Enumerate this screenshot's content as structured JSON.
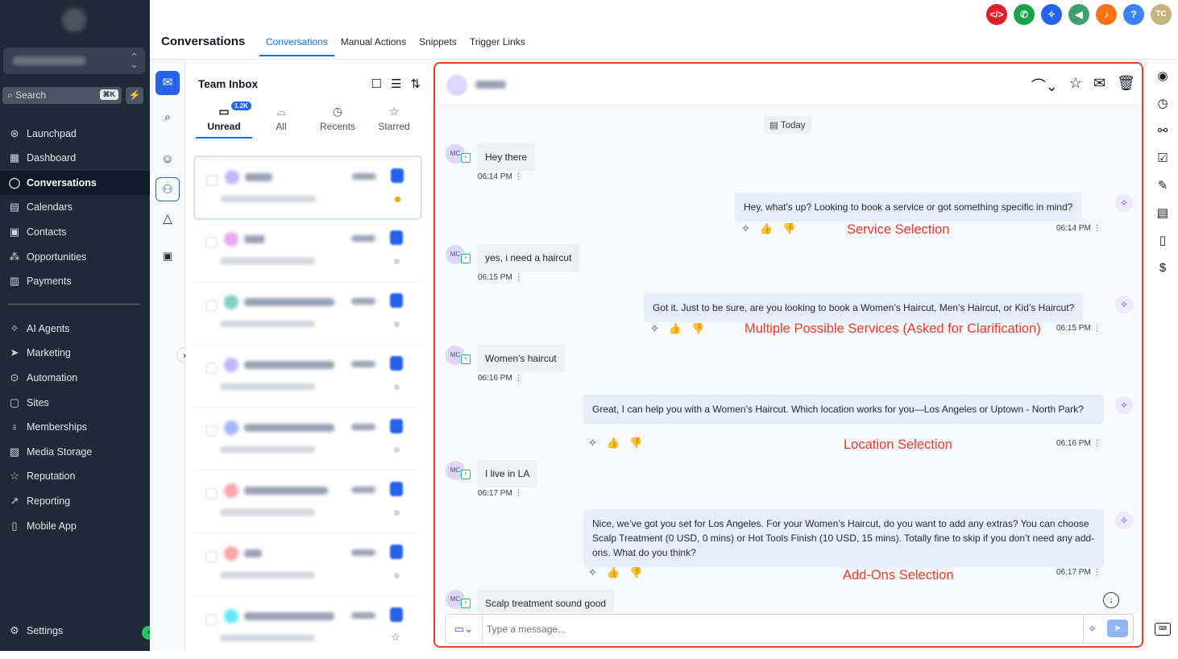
{
  "sidebar": {
    "search_placeholder": "Search",
    "search_shortcut": "⌘K",
    "items": [
      {
        "label": "Launchpad"
      },
      {
        "label": "Dashboard"
      },
      {
        "label": "Conversations"
      },
      {
        "label": "Calendars"
      },
      {
        "label": "Contacts"
      },
      {
        "label": "Opportunities"
      },
      {
        "label": "Payments"
      },
      {
        "label": "AI Agents"
      },
      {
        "label": "Marketing"
      },
      {
        "label": "Automation"
      },
      {
        "label": "Sites"
      },
      {
        "label": "Memberships"
      },
      {
        "label": "Media Storage"
      },
      {
        "label": "Reputation"
      },
      {
        "label": "Reporting"
      },
      {
        "label": "Mobile App"
      }
    ],
    "settings_label": "Settings",
    "active_item": "Conversations"
  },
  "header": {
    "title": "Conversations",
    "tabs": [
      {
        "label": "Conversations"
      },
      {
        "label": "Manual Actions"
      },
      {
        "label": "Snippets"
      },
      {
        "label": "Trigger Links"
      }
    ],
    "active_tab": "Conversations",
    "user_initials": "TC",
    "help_label": "?"
  },
  "inbox": {
    "title": "Team Inbox",
    "tabs": [
      {
        "label": "Unread",
        "badge": "1.2K"
      },
      {
        "label": "All"
      },
      {
        "label": "Recents"
      },
      {
        "label": "Starred"
      }
    ]
  },
  "chat": {
    "date_label": "Today",
    "contact_initials": "MC",
    "messages": [
      {
        "direction": "in",
        "text": "Hey there",
        "time": "06:14 PM"
      },
      {
        "direction": "out",
        "text": "Hey, what's up? Looking to book a service or got something specific in mind?",
        "time": "06:14 PM",
        "annotation": "Service Selection"
      },
      {
        "direction": "in",
        "text": "yes, i need a haircut",
        "time": "06:15 PM"
      },
      {
        "direction": "out",
        "text": "Got it. Just to be sure, are you looking to book a Women’s Haircut, Men’s Haircut, or Kid’s Haircut?",
        "time": "06:15 PM",
        "annotation": "Multiple Possible Services (Asked for Clarification)"
      },
      {
        "direction": "in",
        "text": "Women's haircut",
        "time": "06:16 PM"
      },
      {
        "direction": "out",
        "text": "Great, I can help you with a Women’s Haircut. Which location works for you—Los Angeles or Uptown - North Park?",
        "time": "06:16 PM",
        "annotation": "Location Selection"
      },
      {
        "direction": "in",
        "text": "I live in LA",
        "time": "06:17 PM"
      },
      {
        "direction": "out",
        "text": "Nice, we’ve got you set for Los Angeles. For your Women’s Haircut, do you want to add any extras? You can choose Scalp Treatment (0 USD, 0 mins) or Hot Tools Finish (10 USD, 15 mins). Totally fine to skip if you don’t need any add-ons. What do you think?",
        "time": "06:17 PM",
        "annotation": "Add-Ons Selection"
      },
      {
        "direction": "in",
        "text": "Scalp treatment sound good",
        "time": ""
      }
    ],
    "composer_placeholder": "Type a message..."
  },
  "colors": {
    "sidebar_bg": "#1f2937",
    "accent": "#1570ef",
    "highlight_border": "#ef3b2d",
    "annotation": "#ef3b2d"
  }
}
